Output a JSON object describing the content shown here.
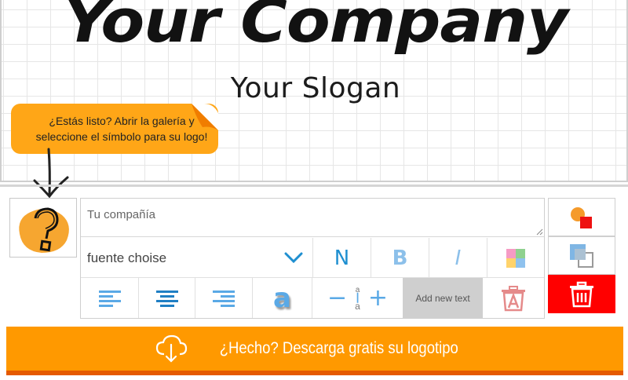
{
  "preview": {
    "company_name": "Your Company",
    "slogan": "Your Slogan"
  },
  "tooltip": {
    "line1": "¿Estás listo? Abrir la galería y",
    "line2": "seleccione el símbolo para su logo!"
  },
  "editor": {
    "text_placeholder": "Tu compañía",
    "font_select_value": "fuente choise",
    "normal_label": "N",
    "bold_label": "B",
    "italic_label": "I",
    "size_decrease": "−",
    "size_increase": "+",
    "size_small": "a",
    "size_large": "a",
    "shadow_letter": "a",
    "add_text_label": "Add new text"
  },
  "download": {
    "label": "¿Hecho? Descarga gratis su logotipo"
  },
  "colors": {
    "accent_orange": "#ff9900",
    "tooltip_orange": "#ffa617",
    "icon_blue": "#5aa9e6",
    "delete_red": "#ff0000"
  },
  "icons": [
    "question-symbol-icon",
    "chevron-down-icon",
    "color-palette-icon",
    "align-left-icon",
    "align-center-icon",
    "align-right-icon",
    "text-shadow-icon",
    "delete-text-icon",
    "shape-color-icon",
    "layers-icon",
    "trash-icon",
    "cloud-download-icon"
  ]
}
